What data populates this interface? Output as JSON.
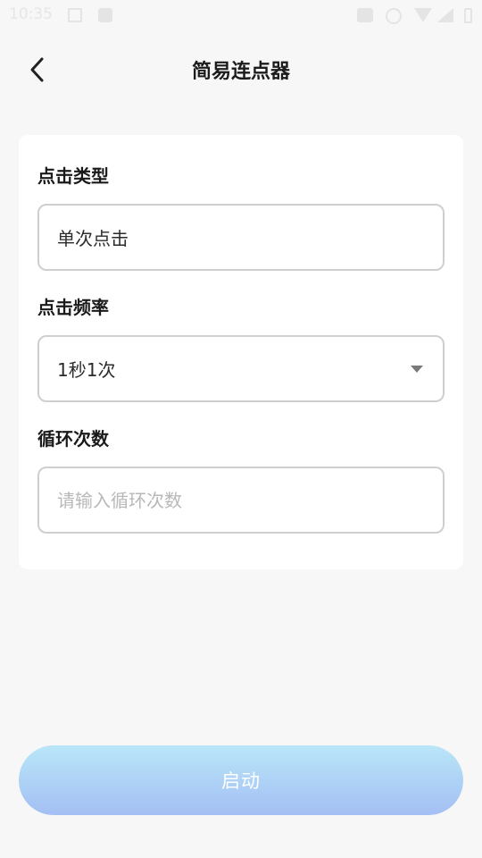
{
  "status_bar": {
    "time": "10:35",
    "icons": [
      "image-icon",
      "download-icon",
      "briefcase-icon",
      "dnd-icon",
      "wifi-icon",
      "signal-icon",
      "battery-icon"
    ]
  },
  "header": {
    "title": "简易连点器",
    "back_icon": "chevron-left-icon"
  },
  "form": {
    "click_type": {
      "label": "点击类型",
      "value": "单次点击"
    },
    "click_frequency": {
      "label": "点击频率",
      "value": "1秒1次",
      "icon": "caret-down-icon"
    },
    "loop_count": {
      "label": "循环次数",
      "value": "",
      "placeholder": "请输入循环次数"
    }
  },
  "start_button": {
    "label": "启动"
  },
  "colors": {
    "background": "#f7f7f7",
    "card": "#ffffff",
    "field_border": "#cfcfcf",
    "button_gradient_top": "#b9e6f8",
    "button_gradient_bottom": "#a4bff4",
    "button_text": "#ffffff",
    "placeholder": "#b8b8b8"
  }
}
